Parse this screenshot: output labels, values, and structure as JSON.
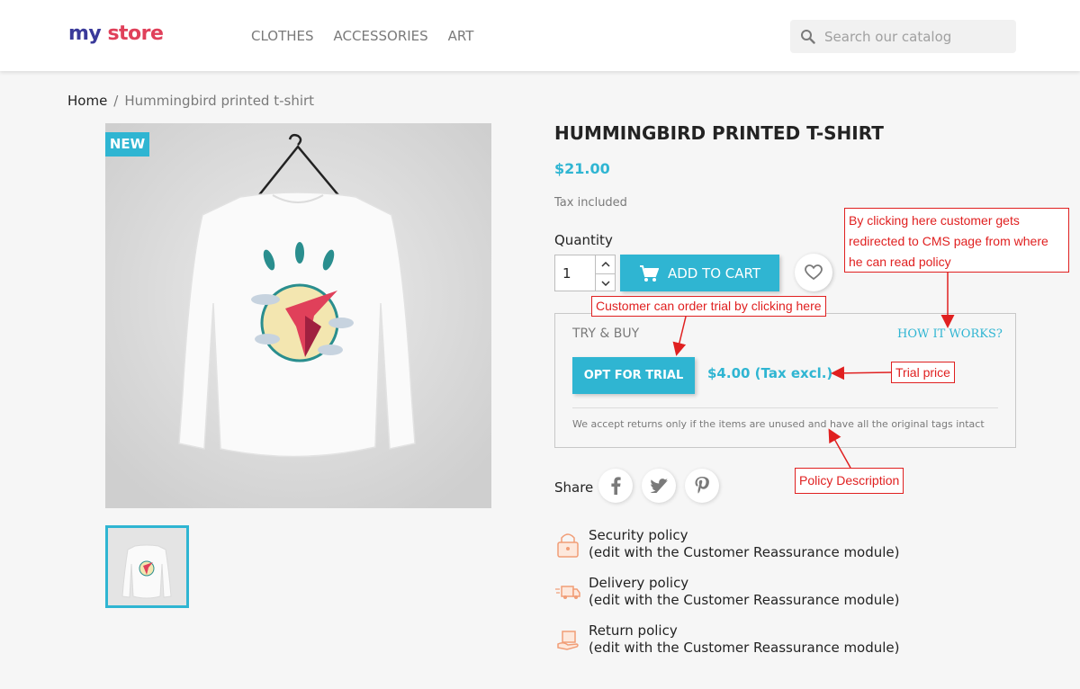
{
  "header": {
    "logo_part1": "my",
    "logo_part2": "store",
    "nav": [
      "CLOTHES",
      "ACCESSORIES",
      "ART"
    ],
    "search_placeholder": "Search our catalog"
  },
  "breadcrumb": {
    "home": "Home",
    "separator": "/",
    "current": "Hummingbird printed t-shirt"
  },
  "product": {
    "badge": "NEW",
    "title": "HUMMINGBIRD PRINTED T-SHIRT",
    "price": "$21.00",
    "tax": "Tax included",
    "quantity_label": "Quantity",
    "quantity": "1",
    "add_to_cart": "ADD TO CART"
  },
  "trial": {
    "label": "TRY & BUY",
    "how_works": "HOW IT WORKS?",
    "button": "OPT FOR TRIAL",
    "price": "$4.00 (Tax excl.)",
    "policy": "We accept returns only if the items are unused and have all the original tags intact"
  },
  "share": {
    "label": "Share",
    "networks": [
      "facebook-icon",
      "twitter-icon",
      "pinterest-icon"
    ]
  },
  "reassurance": [
    {
      "title": "Security policy",
      "subtitle": "(edit with the Customer Reassurance module)",
      "icon": "lock-icon"
    },
    {
      "title": "Delivery policy",
      "subtitle": "(edit with the Customer Reassurance module)",
      "icon": "truck-icon"
    },
    {
      "title": "Return policy",
      "subtitle": "(edit with the Customer Reassurance module)",
      "icon": "return-box-icon"
    }
  ],
  "annotations": {
    "cms_line1": "By clicking here customer gets",
    "cms_line2": "redirected to CMS page from where",
    "cms_line3": "he can read policy",
    "order_trial": "Customer can order trial by clicking here",
    "trial_price": "Trial price",
    "policy_description": "Policy Description"
  },
  "colors": {
    "accent": "#2fb5d2",
    "annotation": "#e02020",
    "text": "#232323",
    "muted": "#7a7a7a"
  }
}
